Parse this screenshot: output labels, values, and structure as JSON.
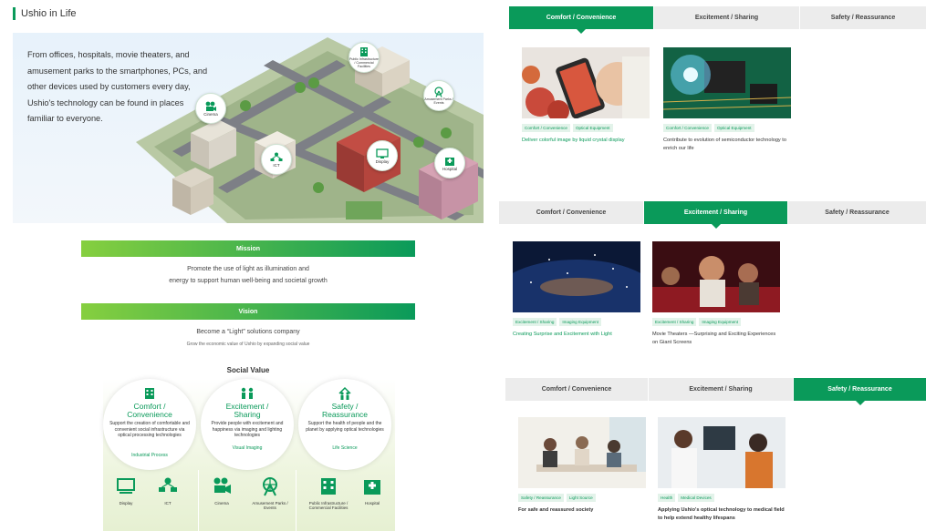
{
  "section_title": "Ushio in Life",
  "hero": {
    "text": "From offices, hospitals, movie theaters, and amusement parks to the smartphones, PCs, and other devices used by customers every day, Ushio's technology can be found in places familiar to everyone.",
    "bubbles": {
      "cinema": "Cinema",
      "public": "Public Infrastructure / Commercial Facilities",
      "amusement": "Amusement Parks / Events",
      "ict": "ICT",
      "display": "Display",
      "hospital": "Hospital"
    }
  },
  "mission": {
    "label": "Mission",
    "line1": "Promote the use of light as illumination and",
    "line2": "energy to support human well-being and societal growth"
  },
  "vision": {
    "label": "Vision",
    "text": "Become a “Light” solutions company",
    "subtext": "Grow the economic value of Ushio by expanding social value"
  },
  "social_value": {
    "title": "Social Value",
    "columns": [
      {
        "heading1": "Comfort /",
        "heading2": "Convenience",
        "body": "Support the creation of comfortable and convenient social infrastructure via optical processing technologies",
        "link": "Industrial Process",
        "icons": [
          "Display",
          "ICT"
        ]
      },
      {
        "heading1": "Excitement /",
        "heading2": "Sharing",
        "body": "Provide people with excitement and happiness via imaging and lighting technologies",
        "link": "Visual Imaging",
        "icons": [
          "Cinema",
          "Amusement Parks / Events"
        ]
      },
      {
        "heading1": "Safety /",
        "heading2": "Reassurance",
        "body": "Support the health of people and the planet by applying optical technologies",
        "link": "Life Science",
        "icons": [
          "Public Infrastructure / Commercial Facilities",
          "Hospital"
        ]
      }
    ]
  },
  "tab_labels": [
    "Comfort / Convenience",
    "Excitement / Sharing",
    "Safety / Reassurance"
  ],
  "panels": [
    {
      "active": 0,
      "cards": [
        {
          "tags": [
            "Comfort / Convenience",
            "Optical Equipment"
          ],
          "caption": "Deliver colorful image by liquid crystal display"
        },
        {
          "tags": [
            "Comfort / Convenience",
            "Optical Equipment"
          ],
          "caption": "Contribute to evolution of semiconductor technology to enrich our life"
        }
      ]
    },
    {
      "active": 1,
      "cards": [
        {
          "tags": [
            "Excitement / Sharing",
            "Imaging Equipment"
          ],
          "caption": "Creating Surprise and Excitement with Light"
        },
        {
          "tags": [
            "Excitement / Sharing",
            "Imaging Equipment"
          ],
          "caption": "Movie Theaters —Surprising and Exciting Experiences on Giant Screens"
        }
      ]
    },
    {
      "active": 2,
      "cards": [
        {
          "tags": [
            "Safety / Reassurance",
            "Light Source"
          ],
          "caption": "For safe and reassured society"
        },
        {
          "tags": [
            "Health",
            "Medical Devices"
          ],
          "caption": "Applying Ushio's optical technology to medical field to help extend healthy lifespans"
        }
      ]
    }
  ],
  "colors": {
    "brand_green": "#0a9a5a",
    "light_green": "#86cf3f",
    "tab_gray": "#ececec"
  }
}
